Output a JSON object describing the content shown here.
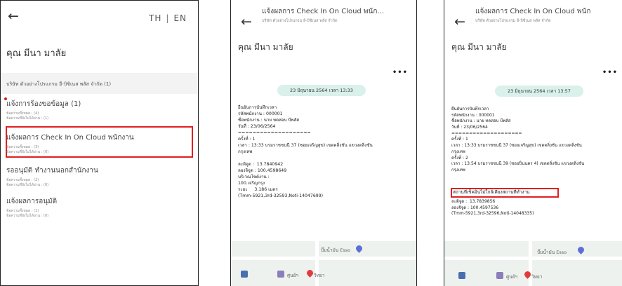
{
  "panel1": {
    "lang": {
      "th": "TH",
      "sep": "|",
      "en": "EN"
    },
    "user_name": "คุณ มีนา มาลัย",
    "company": "บริษัท ตัวอย่างโปรแกรม อี-บิซิเนส พลัส จำกัด (1)",
    "items": [
      {
        "title": "แจ้งการร้องขอข้อมูล (1)",
        "sub1": "ข้อความทั้งหมด : (4)",
        "sub2": "ข้อความที่ยังไม่ได้อ่าน : (1)"
      },
      {
        "title": "แจ้งผลการ Check In On Cloud พนักงาน",
        "sub1": "ข้อความทั้งหมด : (3)",
        "sub2": "ข้อความที่ยังไม่ได้อ่าน : (0)"
      },
      {
        "title": "รออนุมัติ ทำงานนอกสำนักงาน",
        "sub1": "ข้อความทั้งหมด : (2)",
        "sub2": "ข้อความที่ยังไม่ได้อ่าน : (0)"
      },
      {
        "title": "แจ้งผลการอนุมัติ",
        "sub1": "ข้อความทั้งหมด : (1)",
        "sub2": "ข้อความที่ยังไม่ได้อ่าน : (0)"
      }
    ]
  },
  "panel2": {
    "title": "แจ้งผลการ Check In On Cloud พนัก...",
    "subtitle": "บริษัท ตัวอย่างโปรแกรม อี-บิซิเนส พลัส จำกัด",
    "user_name": "คุณ มีนา มาลัย",
    "more": "•••",
    "date": "23 มิถุนายน 2564 เวลา 13:33",
    "message": "ยืนยันการบันทึกเวลา\nรหัสพนักงาน : 000001\nชื่อพนักงาน : นาย ทดสอบ บีพลัส\nวันที่ : 23/06/2564\n====================\nครั้งที่ : 1\nเวลา : 13:33 บรมราชชนนี 37 (ซอยเจริญสุข) เขตตลิ่งชัน แขวงตลิ่งชัน\nกรุงเทพ\n\nละติจูด :  13.7840942\nลองจิจูด : 100.4598649\nบริเวณไซต์งาน :\n100.เจริญกรุง\nระยะ     3.186 เมตร\n(Tmm-5921,3rd-32593,Noti-14047699)",
    "map_label1": "ปั๊มน้ำมัน Esso",
    "map_label2": "ศูนย์ฯ",
    "map_label3": "วิทยา"
  },
  "panel3": {
    "title": "แจ้งผลการ Check In On Cloud พนัก",
    "subtitle": "บริษัท ตัวอย่างโปรแกรม อี-บิซิเนส พลัส จำกัด",
    "user_name": "คุณ มีนา มาลัย",
    "more": "•••",
    "date": "23 มิถุนายน 2564 เวลา 13:57",
    "message_top": "ยืนยันการบันทึกเวลา\nรหัสพนักงาน : 000001\nชื่อพนักงาน : นาย ทดสอบ บีพลัส\nวันที่ : 23/06/2564\n====================\nครั้งที่ : 1\nเวลา : 13:33 บรมราชชนนี 37 (ซอยเจริญสุข) เขตตลิ่งชัน แขวงตลิ่งชัน\nกรุงเทพ\nครั้งที่ : 2\nเวลา : 13:54 บรมราชชนนี 39 (ซอยปิ่นนคร 4) เขตตลิ่งชัน แขวงตลิ่งชัน\nกรุงเทพ",
    "warning": "สถานที่เช็คอินไม่ใกล้เคียงสถานที่ทำงาน",
    "message_bottom": "ละติจูด :  13.7839856\nลองจิจูด : 100.4597536\n(Tmm-5921,3rd-32596,Noti-14048335)",
    "map_label1": "ปั๊มน้ำมัน Esso",
    "map_label2": "ศูนย์ฯ",
    "map_label3": "วิทยา"
  },
  "colors": {
    "highlight": "#e02020",
    "pill": "#d9f1ea",
    "pin_blue": "#5b6fd6",
    "pin_red": "#e23b3b"
  },
  "icons": {
    "back": "arrow-left-icon",
    "more": "more-horizontal-icon",
    "map_pin": "map-pin-icon"
  }
}
